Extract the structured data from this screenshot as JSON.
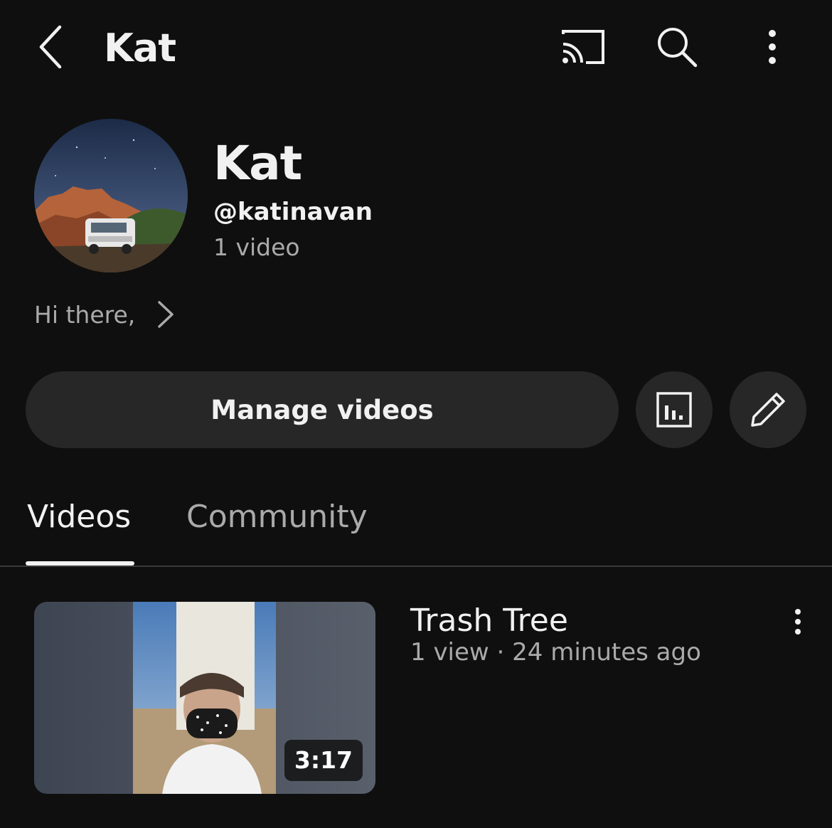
{
  "top_bar": {
    "title": "Kat",
    "icons": [
      "back-arrow-icon",
      "cast-icon",
      "search-icon",
      "more-vert-icon"
    ]
  },
  "channel": {
    "name": "Kat",
    "handle": "@katinavan",
    "video_count": "1 video",
    "description": "Hi there,"
  },
  "actions": {
    "manage_label": "Manage videos",
    "icons": [
      "analytics-icon",
      "edit-pencil-icon"
    ]
  },
  "tabs": [
    {
      "label": "Videos",
      "selected": true
    },
    {
      "label": "Community",
      "selected": false
    }
  ],
  "videos": [
    {
      "title": "Trash Tree",
      "meta": "1 view · 24 minutes ago",
      "duration": "3:17"
    }
  ],
  "colors": {
    "background": "#0f0f0f",
    "button_bg": "#272727",
    "primary_text": "#f1f1f1",
    "secondary_text": "#aaaaaa"
  }
}
